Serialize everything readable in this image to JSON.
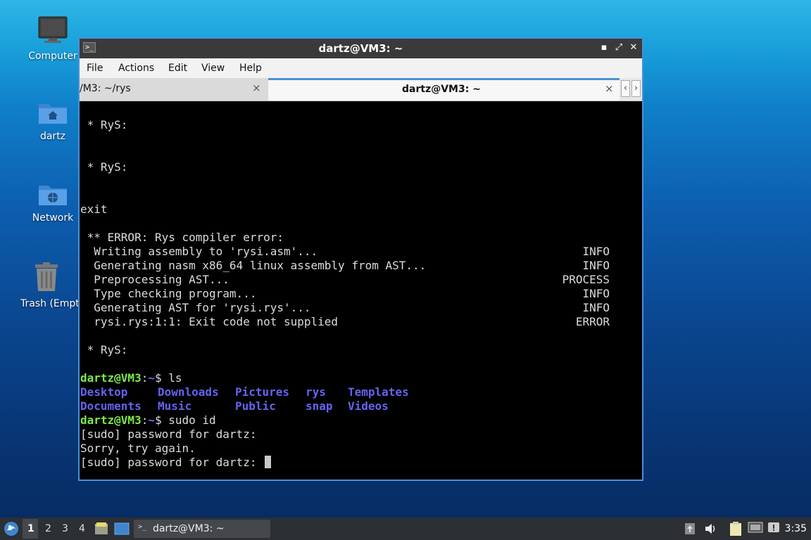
{
  "desktop": {
    "icons": [
      {
        "label": "Computer",
        "icon": "computer-icon"
      },
      {
        "label": "dartz",
        "icon": "home-folder-icon"
      },
      {
        "label": "Network",
        "icon": "network-folder-icon"
      },
      {
        "label": "Trash (Empty)",
        "icon": "trash-icon"
      }
    ]
  },
  "window": {
    "title": "dartz@VM3: ~",
    "menu": [
      "File",
      "Actions",
      "Edit",
      "View",
      "Help"
    ],
    "tabs": [
      {
        "label": "/M3: ~/rys",
        "close": "×"
      },
      {
        "label": "dartz@VM3: ~",
        "close": "×"
      }
    ],
    "tab_scroll": {
      "left": "‹",
      "right": "›"
    },
    "controls": {
      "minimize": "▪",
      "maximize": "⤢",
      "close": "✕"
    }
  },
  "terminal": {
    "rys1": " * RyS:",
    "rys2": " * RyS:",
    "exit": "exit",
    "error": " ** ERROR: Rys compiler error:",
    "log": [
      {
        "msg": "  Writing assembly to 'rysi.asm'...",
        "level": "INFO"
      },
      {
        "msg": "  Generating nasm x86_64 linux assembly from AST...",
        "level": "INFO"
      },
      {
        "msg": "  Preprocessing AST...",
        "level": "PROCESS"
      },
      {
        "msg": "  Type checking program...",
        "level": "INFO"
      },
      {
        "msg": "  Generating AST for 'rysi.rys'...",
        "level": "INFO"
      },
      {
        "msg": "  rysi.rys:1:1: Exit code not supplied",
        "level": "ERROR"
      }
    ],
    "rys3": " * RyS:",
    "prompt_user": "dartz@VM3",
    "prompt_sep": ":",
    "prompt_path": "~",
    "prompt_sign": "$ ",
    "cmd1": "ls",
    "ls_row1": [
      "Desktop",
      "Downloads",
      "Pictures",
      "rys",
      "Templates"
    ],
    "ls_row2": [
      "Documents",
      "Music",
      "Public",
      "snap",
      "Videos"
    ],
    "cmd2": "sudo id",
    "sudo1": "[sudo] password for dartz:",
    "sorry": "Sorry, try again.",
    "sudo2": "[sudo] password for dartz: "
  },
  "taskbar": {
    "workspaces": [
      "1",
      "2",
      "3",
      "4"
    ],
    "active_workspace": "1",
    "task_label": "dartz@VM3: ~",
    "clock": "3:35"
  }
}
